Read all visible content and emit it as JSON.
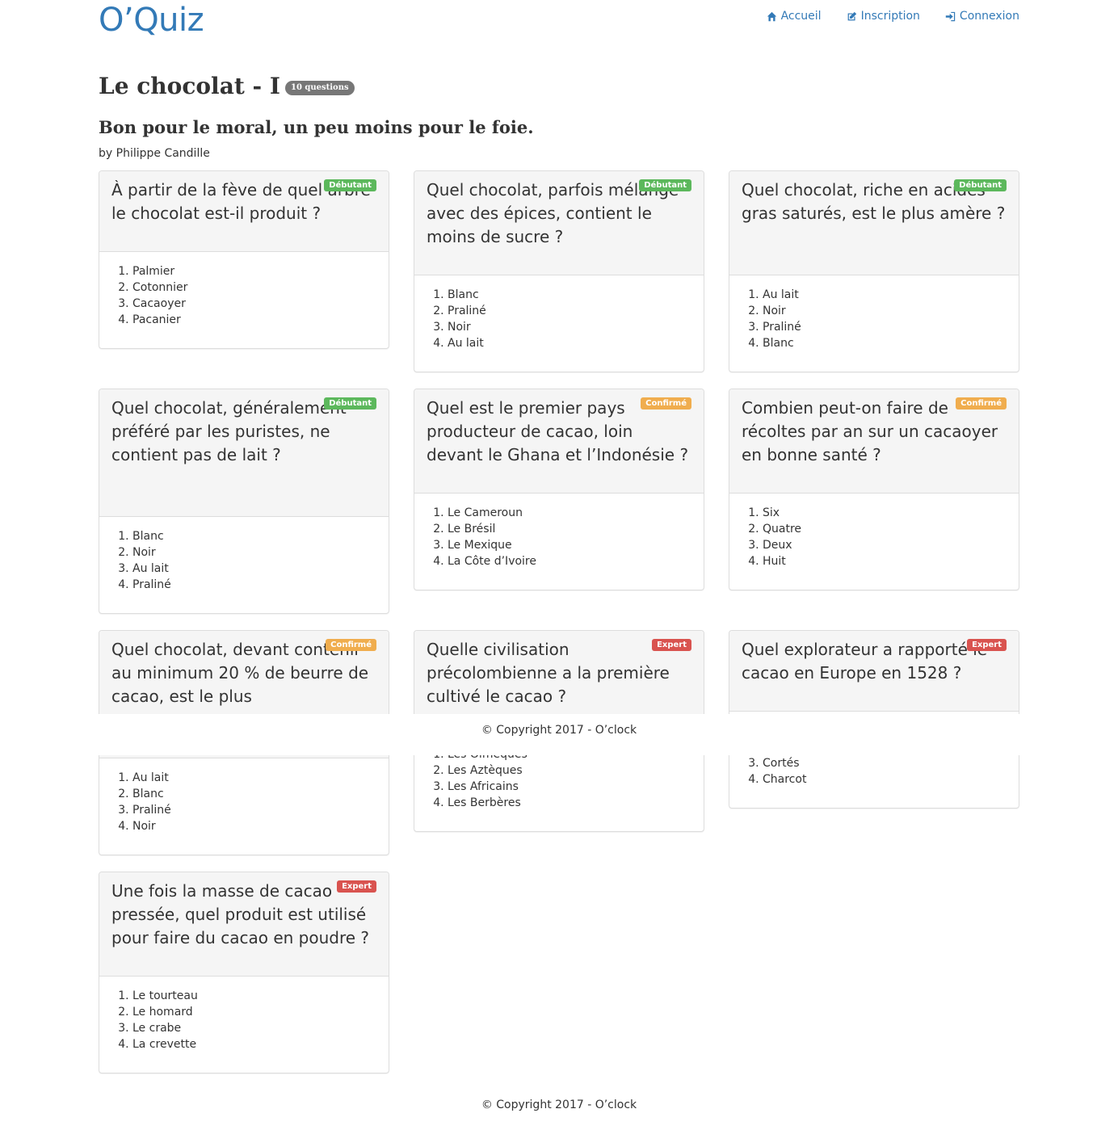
{
  "header": {
    "brand": "O’Quiz",
    "nav": [
      {
        "label": "Accueil",
        "icon": "home-icon"
      },
      {
        "label": "Inscription",
        "icon": "edit-icon"
      },
      {
        "label": "Connexion",
        "icon": "sign-in-icon"
      }
    ]
  },
  "quiz": {
    "title": "Le chocolat - I",
    "count": "10 questions",
    "subtitle": "Bon pour le moral, un peu moins pour le foie.",
    "author": "by Philippe Candille"
  },
  "colors": {
    "link": "#337ab7",
    "beginner": "#5cb85c",
    "confirmed": "#f0ad4e",
    "expert": "#d9534f"
  },
  "questions": [
    {
      "text": "À partir de la fève de quel arbre le chocolat est-il produit ?",
      "level": "Débutant",
      "answers": [
        "Palmier",
        "Cotonnier",
        "Cacaoyer",
        "Pacanier"
      ]
    },
    {
      "text": "Quel chocolat, parfois mélangé avec des épices, contient le moins de sucre ?",
      "level": "Débutant",
      "answers": [
        "Blanc",
        "Praliné",
        "Noir",
        "Au lait"
      ]
    },
    {
      "text": "Quel chocolat, riche en acides gras saturés, est le plus amère ?",
      "level": "Débutant",
      "answers": [
        "Au lait",
        "Noir",
        "Praliné",
        "Blanc"
      ]
    },
    {
      "text": "Quel chocolat, généralement préféré par les puristes, ne contient pas de lait ?",
      "level": "Débutant",
      "answers": [
        "Blanc",
        "Noir",
        "Au lait",
        "Praliné"
      ]
    },
    {
      "text": "Quel est le premier pays producteur de cacao, loin devant le Ghana et l’Indonésie ?",
      "level": "Confirmé",
      "answers": [
        "Le Cameroun",
        "Le Brésil",
        "Le Mexique",
        "La Côte d’Ivoire"
      ]
    },
    {
      "text": "Combien peut-on faire de récoltes par an sur un cacaoyer en bonne santé ?",
      "level": "Confirmé",
      "answers": [
        "Six",
        "Quatre",
        "Deux",
        "Huit"
      ]
    },
    {
      "text": "Quel chocolat, devant contenir au minimum 20 % de beurre de cacao, est le plus",
      "level": "Confirmé",
      "answers": [
        "Au lait",
        "Blanc",
        "Praliné",
        "Noir"
      ]
    },
    {
      "text": "Quelle civilisation précolombienne a la première cultivé le cacao ?",
      "level": "Expert",
      "answers": [
        "Les Olmèques",
        "Les Aztèques",
        "Les Africains",
        "Les Berbères"
      ]
    },
    {
      "text": "Quel explorateur a rapporté le cacao en Europe en 1528 ?",
      "level": "Expert",
      "answers": [
        "",
        "",
        "Cortés",
        "Charcot"
      ]
    },
    {
      "text": "Une fois la masse de cacao pressée, quel produit est utilisé pour faire du cacao en poudre ?",
      "level": "Expert",
      "answers": [
        "Le tourteau",
        "Le homard",
        "Le crabe",
        "La crevette"
      ]
    }
  ],
  "footer": {
    "copyright": "© Copyright 2017 - O’clock"
  }
}
